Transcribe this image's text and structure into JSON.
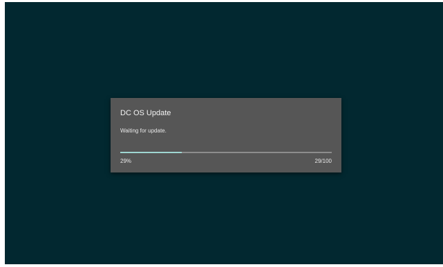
{
  "dialog": {
    "title": "DC OS Update",
    "message": "Waiting for update.",
    "progress": {
      "percent_label": "29%",
      "count_label": "29/100",
      "value": 29,
      "max": 100,
      "fill_color": "#9fd6d2",
      "track_color": "#8d8d8d"
    }
  },
  "colors": {
    "screen_background": "#022830",
    "dialog_background": "#565656"
  }
}
